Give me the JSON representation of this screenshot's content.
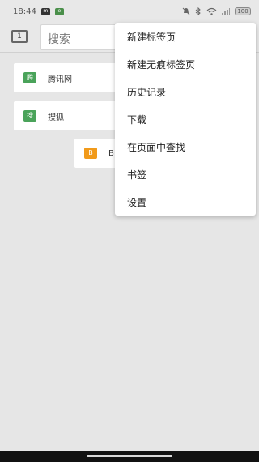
{
  "status_bar": {
    "time": "18:44",
    "badge_1": "m",
    "badge_2": "e",
    "battery": "100"
  },
  "toolbar": {
    "tab_count": "1",
    "search_placeholder": "搜索"
  },
  "shortcuts": [
    {
      "badge_text": "腾",
      "label": "腾讯网",
      "color": "#4aa35a"
    },
    {
      "badge_text": "搜",
      "label": "搜狐",
      "color": "#4aa35a"
    },
    {
      "badge_text": "B",
      "label": "B",
      "color": "#f19a1a"
    }
  ],
  "menu": {
    "items": [
      "新建标签页",
      "新建无痕标签页",
      "历史记录",
      "下载",
      "在页面中查找",
      "书签",
      "设置"
    ]
  }
}
